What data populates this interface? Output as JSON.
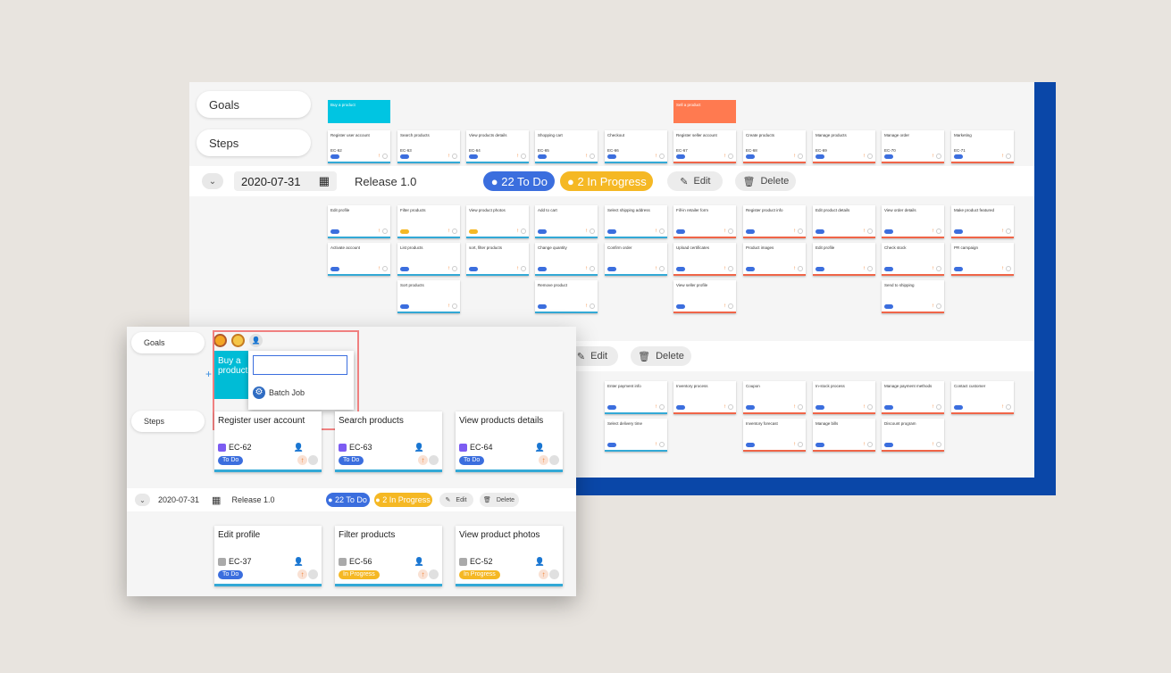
{
  "board": {
    "goals_label": "Goals",
    "steps_label": "Steps",
    "goals": [
      {
        "title": "Buy a product",
        "color": "#00c5e2"
      },
      {
        "title": "Sell a product",
        "color": "#ff7a50"
      }
    ],
    "steps": [
      "Register user account",
      "Search products",
      "View products details",
      "Shopping cart",
      "Checkout",
      "Register seller account",
      "Create products",
      "Manage products",
      "Manage order",
      "Marketing"
    ],
    "step_ids": [
      "EC-62",
      "EC-63",
      "EC-64",
      "EC-65",
      "EC-66",
      "EC-67",
      "EC-68",
      "EC-69",
      "EC-70",
      "EC-71"
    ],
    "release": {
      "date": "2020-07-31",
      "name": "Release 1.0",
      "todo": "● 22 To Do",
      "inprog": "● 2 In Progress",
      "edit": "Edit",
      "delete": "Delete"
    },
    "rows": [
      [
        "Edit profile",
        "Filter products",
        "View product photos",
        "Add to cart",
        "Select shipping address",
        "Fill-in retailer form",
        "Register product info",
        "Edit product details",
        "View order details",
        "Make product featured"
      ],
      [
        "Activate account",
        "List products",
        "sort, filter products",
        "Change quantity",
        "Confirm order",
        "Upload certificates",
        "Product images",
        "Edit profile",
        "Check stock",
        "PR campaign"
      ],
      [
        "",
        "Sort products",
        "",
        "Remove product",
        "",
        "View seller profile",
        "",
        "",
        "Send to shipping",
        ""
      ]
    ],
    "rows2": [
      [
        "Enter payment info",
        "Inventory process",
        "Coupon",
        "In-stock process",
        "Manage payment methods",
        "Contact customer"
      ],
      [
        "Select delivery time",
        "",
        "Inventory forecast",
        "Manage bills",
        "Discount program",
        ""
      ]
    ],
    "release2": {
      "edit": "Edit",
      "delete": "Delete"
    }
  },
  "zoom": {
    "goals_label": "Goals",
    "steps_label": "Steps",
    "goal_title": "Buy a product",
    "search_value": "",
    "batch_job": "Batch Job",
    "steps": [
      {
        "title": "Register user account",
        "id": "EC-62",
        "status": "To Do"
      },
      {
        "title": "Search products",
        "id": "EC-63",
        "status": "To Do"
      },
      {
        "title": "View products details",
        "id": "EC-64",
        "status": "To Do"
      }
    ],
    "release": {
      "date": "2020-07-31",
      "name": "Release 1.0",
      "todo": "● 22 To Do",
      "inprog": "● 2 In Progress",
      "edit": "Edit",
      "delete": "Delete"
    },
    "stories": [
      {
        "title": "Edit profile",
        "id": "EC-37",
        "status": "To Do"
      },
      {
        "title": "Filter products",
        "id": "EC-56",
        "status": "In Progress"
      },
      {
        "title": "View product photos",
        "id": "EC-52",
        "status": "In Progress"
      }
    ]
  }
}
